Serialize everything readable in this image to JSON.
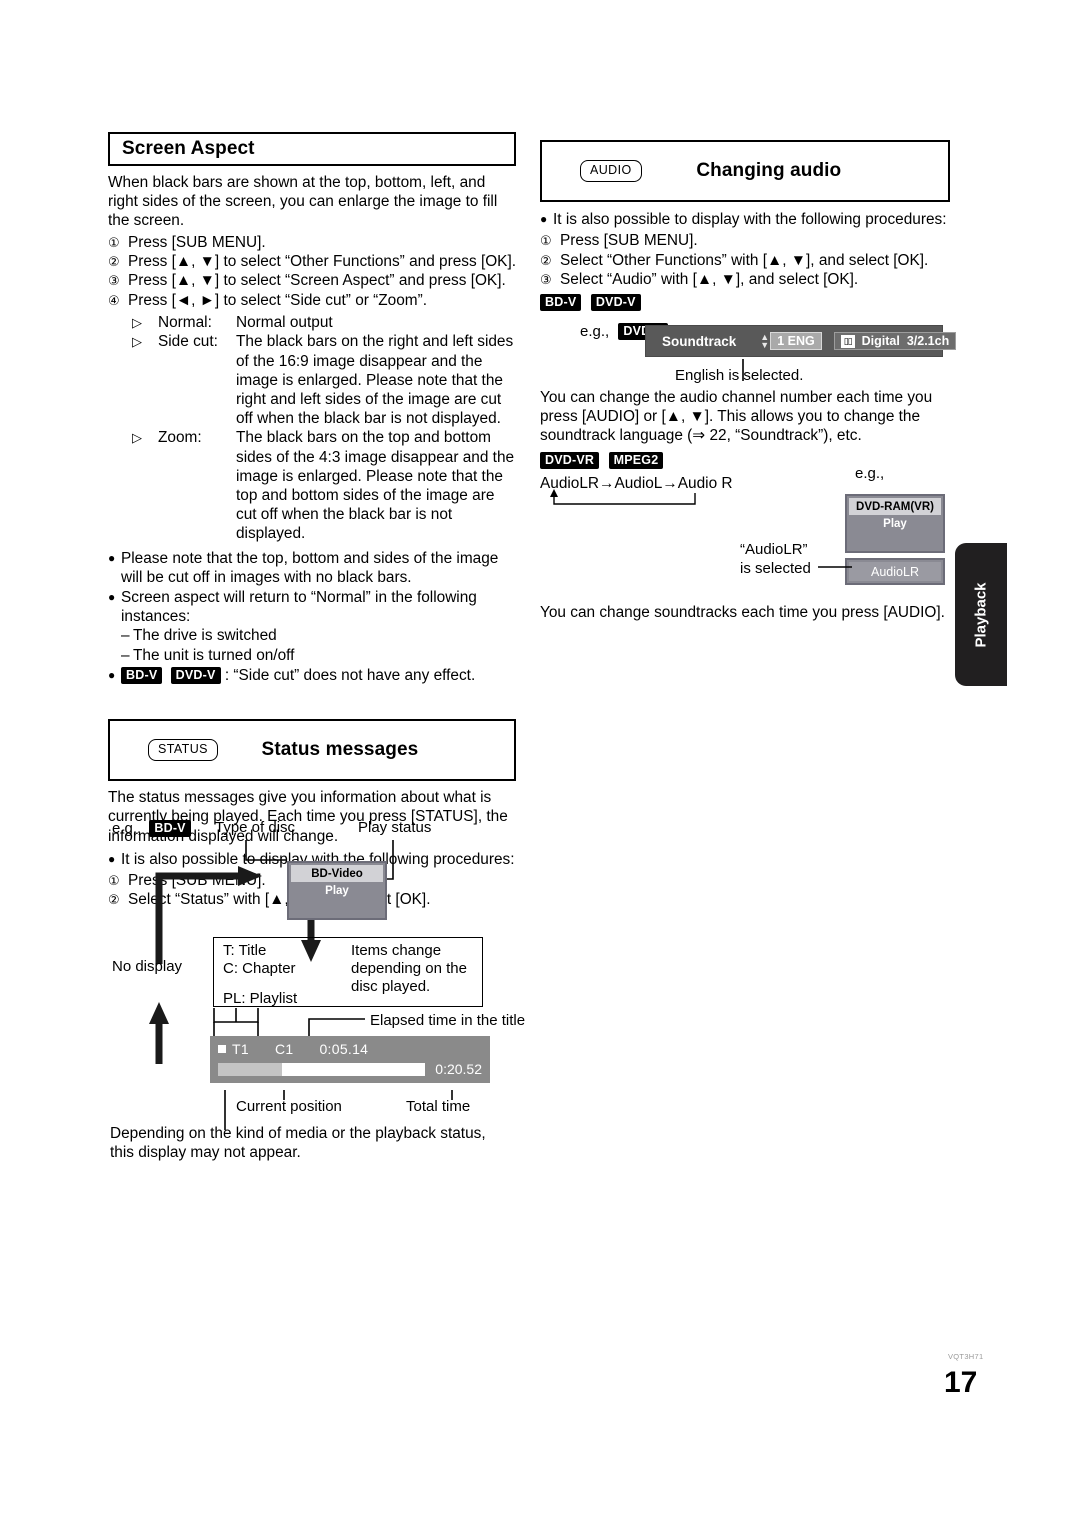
{
  "page": {
    "number": "17",
    "doc_code": "VQT3H71",
    "side_tab": "Playback"
  },
  "screen_aspect": {
    "title": "Screen Aspect",
    "intro": "When black bars are shown at the top, bottom, left, and right sides of the screen, you can enlarge the image to fill the screen.",
    "steps": [
      {
        "num": "①",
        "text": "Press [SUB MENU]."
      },
      {
        "num": "②",
        "text": "Press [▲, ▼] to select “Other Functions” and press [OK]."
      },
      {
        "num": "③",
        "text": "Press [▲, ▼] to select “Screen Aspect” and press [OK]."
      },
      {
        "num": "④",
        "text": "Press [◄, ►] to select “Side cut” or “Zoom”."
      }
    ],
    "options": [
      {
        "label": "Normal:",
        "desc": "Normal output"
      },
      {
        "label": "Side cut:",
        "desc": "The black bars on the right and left sides of the 16:9 image disappear and the image is enlarged. Please note that the right and left sides of the image are cut off when the black bar is not displayed."
      },
      {
        "label": "Zoom:",
        "desc": "The black bars on the top and bottom sides of the 4:3 image disappear and the image is enlarged. Please note that the top and bottom sides of the image are cut off when the black bar is not displayed."
      }
    ],
    "notes": [
      "Please note that the top, bottom and sides of the image will be cut off in images with no black bars.",
      "Screen aspect will return to “Normal” in the following instances:"
    ],
    "sub_notes": [
      "The drive is switched",
      "The unit is turned on/off"
    ],
    "final_note": {
      "badges": [
        "BD-V",
        "DVD-V"
      ],
      "text": ": “Side cut” does not have any effect."
    }
  },
  "status_messages": {
    "keycap": "STATUS",
    "title": "Status messages",
    "intro": "The status messages give you information about what is currently being played. Each time you press [STATUS], the information displayed will change.",
    "bullet": "It is also possible to display with the following procedures:",
    "steps": [
      {
        "num": "①",
        "text": "Press [SUB MENU]."
      },
      {
        "num": "②",
        "text": "Select “Status” with [▲, ▼], and select [OK]."
      }
    ],
    "example_prefix": "e.g.,",
    "example_badge": "BD-V",
    "callouts": {
      "type_of_disc": "Type of disc",
      "play_status": "Play status",
      "no_display": "No display",
      "items_change": "Items change depending on the disc played.",
      "elapsed": "Elapsed time in the title",
      "current_position": "Current position",
      "total_time": "Total time"
    },
    "osd_disc": {
      "disc_type": "BD-Video",
      "play_state": "Play"
    },
    "info_box": {
      "line1": "T: Title",
      "line2": "C: Chapter",
      "line3": "PL: Playlist"
    },
    "status_bar": {
      "title_no": "T1",
      "chapter_no": "C1",
      "elapsed": "0:05.14",
      "total": "0:20.52",
      "progress_percent": 31
    },
    "closing": "Depending on the kind of media or the playback status, this display may not appear."
  },
  "changing_audio": {
    "keycap": "AUDIO",
    "title": "Changing audio",
    "bullet": "It is also possible to display with the following procedures:",
    "steps": [
      {
        "num": "①",
        "text": "Press [SUB MENU]."
      },
      {
        "num": "②",
        "text": "Select “Other Functions” with [▲, ▼], and select [OK]."
      },
      {
        "num": "③",
        "text": "Select “Audio” with [▲, ▼], and select [OK]."
      }
    ],
    "badges_1": [
      "BD-V",
      "DVD-V"
    ],
    "example_prefix": "e.g.,",
    "example_badge": "DVD-V",
    "soundtrack_osd": {
      "label": "Soundtrack",
      "channel": "1 ENG",
      "format_mark": "□□",
      "format": "Digital",
      "channels": "3/2.1ch",
      "up_arrow": "▲",
      "down_arrow": "▼"
    },
    "caption_english": "English is selected.",
    "paragraph": "You can change the audio channel number each time you press [AUDIO] or [▲, ▼]. This allows you to change the soundtrack language (⇒ 22, “Soundtrack”), etc.",
    "badges_2": [
      "DVD-VR",
      "MPEG2"
    ],
    "cycle": {
      "item1": "AudioLR",
      "item2": "AudioL",
      "item3": "Audio R",
      "arrow": "→"
    },
    "example2_prefix": "e.g.,",
    "osd_disc": {
      "disc_type": "DVD-RAM(VR)",
      "play_state": "Play",
      "selection": "AudioLR"
    },
    "callout_selected_line1": "“AudioLR”",
    "callout_selected_line2": "is selected",
    "closing": "You can change soundtracks each time you press [AUDIO]."
  }
}
